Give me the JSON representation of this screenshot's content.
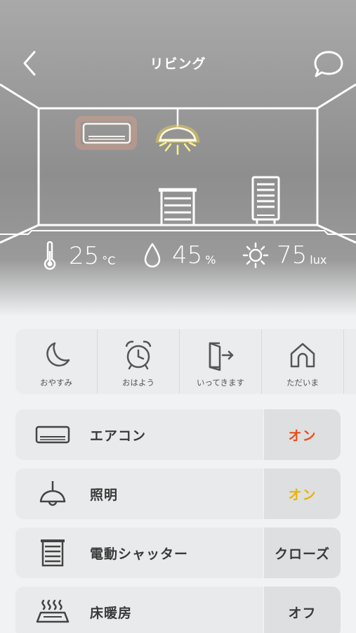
{
  "header": {
    "title": "リビング",
    "back_icon": "chevron-left-icon",
    "chat_icon": "chat-bubble-icon"
  },
  "room": {
    "aircon_color": "#f0a383",
    "light_color": "#f5d84a"
  },
  "sensors": {
    "temperature": {
      "value": "25",
      "unit": "°C",
      "icon": "thermometer-icon"
    },
    "humidity": {
      "value": "45",
      "unit": "%",
      "icon": "droplet-icon"
    },
    "illuminance": {
      "value": "75",
      "unit": "lux",
      "icon": "sun-icon"
    }
  },
  "scenes": [
    {
      "label": "おやすみ",
      "icon": "moon-icon"
    },
    {
      "label": "おはよう",
      "icon": "alarm-clock-icon"
    },
    {
      "label": "いってきます",
      "icon": "door-exit-icon"
    },
    {
      "label": "ただいま",
      "icon": "home-icon"
    }
  ],
  "devices": [
    {
      "name": "エアコン",
      "state": "オン",
      "state_color": "#e8501c",
      "icon": "air-conditioner-icon"
    },
    {
      "name": "照明",
      "state": "オン",
      "state_color": "#e8b400",
      "icon": "pendant-lamp-icon"
    },
    {
      "name": "電動シャッター",
      "state": "クローズ",
      "state_color": "#3a3a3a",
      "icon": "shutter-icon"
    },
    {
      "name": "床暖房",
      "state": "オフ",
      "state_color": "#3a3a3a",
      "icon": "floor-heating-icon"
    }
  ]
}
